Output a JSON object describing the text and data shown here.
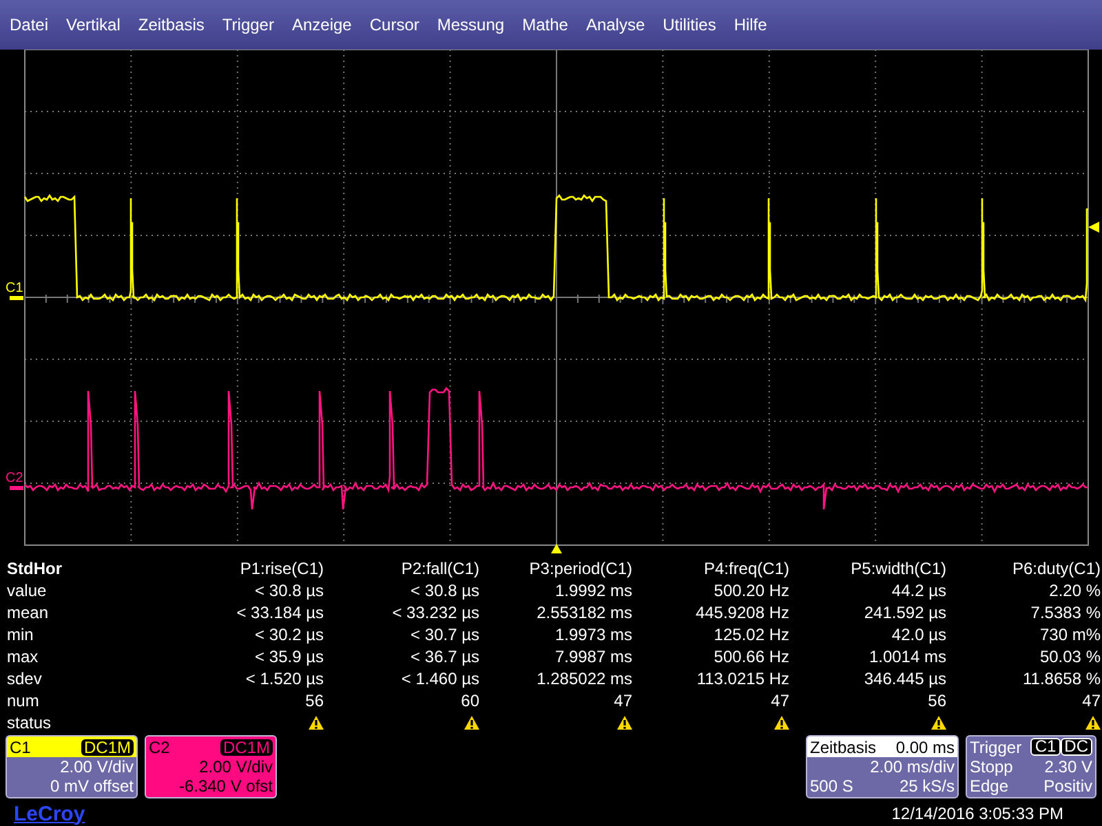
{
  "menu": [
    "Datei",
    "Vertikal",
    "Zeitbasis",
    "Trigger",
    "Anzeige",
    "Cursor",
    "Messung",
    "Mathe",
    "Analyse",
    "Utilities",
    "Hilfe"
  ],
  "traces": [
    {
      "label": "C1",
      "color": "#ffff00"
    },
    {
      "label": "C2",
      "color": "#ff1480"
    }
  ],
  "measurements": {
    "title": "StdHor",
    "columns": [
      "P1:rise(C1)",
      "P2:fall(C1)",
      "P3:period(C1)",
      "P4:freq(C1)",
      "P5:width(C1)",
      "P6:duty(C1)"
    ],
    "rows": [
      {
        "label": "value",
        "cells": [
          "< 30.8 µs",
          "< 30.8 µs",
          "1.9992 ms",
          "500.20 Hz",
          "44.2 µs",
          "2.20 %"
        ]
      },
      {
        "label": "mean",
        "cells": [
          "< 33.184 µs",
          "< 33.232 µs",
          "2.553182 ms",
          "445.9208 Hz",
          "241.592 µs",
          "7.5383 %"
        ]
      },
      {
        "label": "min",
        "cells": [
          "< 30.2 µs",
          "< 30.7 µs",
          "1.9973 ms",
          "125.02 Hz",
          "42.0 µs",
          "730 m%"
        ]
      },
      {
        "label": "max",
        "cells": [
          "< 35.9 µs",
          "< 36.7 µs",
          "7.9987 ms",
          "500.66 Hz",
          "1.0014 ms",
          "50.03 %"
        ]
      },
      {
        "label": "sdev",
        "cells": [
          "< 1.520 µs",
          "< 1.460 µs",
          "1.285022 ms",
          "113.0215 Hz",
          "346.445 µs",
          "11.8658 %"
        ]
      },
      {
        "label": "num",
        "cells": [
          "56",
          "60",
          "47",
          "47",
          "56",
          "47"
        ]
      }
    ],
    "status": {
      "label": "status",
      "warnings": [
        true,
        true,
        true,
        true,
        true,
        true
      ]
    }
  },
  "channels": [
    {
      "name": "C1",
      "coupling": "DC1M",
      "color": "#ffff00",
      "selected": false,
      "scale": "2.00 V/div",
      "offset": "0 mV offset"
    },
    {
      "name": "C2",
      "coupling": "DC1M",
      "color": "#ff0a80",
      "selected": true,
      "scale": "2.00 V/div",
      "offset": "-6.340 V ofst"
    }
  ],
  "timebase": {
    "title": "Zeitbasis",
    "delay": "0.00 ms",
    "scale": "2.00 ms/div",
    "samples": "500 S",
    "rate": "25 kS/s"
  },
  "trigger": {
    "title": "Trigger",
    "source": "C1",
    "coupling": "DC",
    "mode": "Stopp",
    "level": "2.30 V",
    "type": "Edge",
    "slope": "Positiv"
  },
  "logo": "LeCroy",
  "timestamp": "12/14/2016 3:05:33 PM"
}
